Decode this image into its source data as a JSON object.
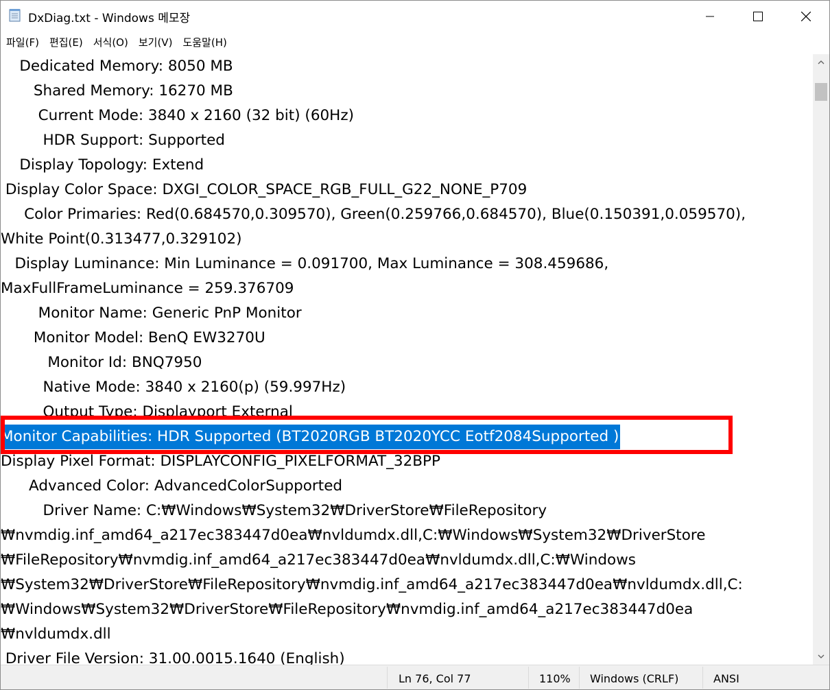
{
  "window": {
    "title": "DxDiag.txt - Windows 메모장"
  },
  "menu": [
    "파일(F)",
    "편집(E)",
    "서식(O)",
    "보기(V)",
    "도움말(H)"
  ],
  "lines": [
    "    Dedicated Memory: 8050 MB",
    "       Shared Memory: 16270 MB",
    "        Current Mode: 3840 x 2160 (32 bit) (60Hz)",
    "         HDR Support: Supported",
    "    Display Topology: Extend",
    " Display Color Space: DXGI_COLOR_SPACE_RGB_FULL_G22_NONE_P709",
    "     Color Primaries: Red(0.684570,0.309570), Green(0.259766,0.684570), Blue(0.150391,0.059570),",
    "White Point(0.313477,0.329102)",
    "   Display Luminance: Min Luminance = 0.091700, Max Luminance = 308.459686,",
    "MaxFullFrameLuminance = 259.376709",
    "        Monitor Name: Generic PnP Monitor",
    "       Monitor Model: BenQ EW3270U",
    "          Monitor Id: BNQ7950",
    "         Native Mode: 3840 x 2160(p) (59.997Hz)",
    "         Output Type: Displayport External",
    "Monitor Capabilities: HDR Supported (BT2020RGB BT2020YCC Eotf2084Supported )",
    "Display Pixel Format: DISPLAYCONFIG_PIXELFORMAT_32BPP",
    "      Advanced Color: AdvancedColorSupported",
    "         Driver Name: C:₩Windows₩System32₩DriverStore₩FileRepository",
    "₩nvmdig.inf_amd64_a217ec383447d0ea₩nvldumdx.dll,C:₩Windows₩System32₩DriverStore",
    "₩FileRepository₩nvmdig.inf_amd64_a217ec383447d0ea₩nvldumdx.dll,C:₩Windows",
    "₩System32₩DriverStore₩FileRepository₩nvmdig.inf_amd64_a217ec383447d0ea₩nvldumdx.dll,C:",
    "₩Windows₩System32₩DriverStore₩FileRepository₩nvmdig.inf_amd64_a217ec383447d0ea",
    "₩nvldumdx.dll",
    " Driver File Version: 31.00.0015.1640 (English)"
  ],
  "selected_line": 15,
  "status": {
    "position": "Ln 76, Col 77",
    "zoom": "110%",
    "line_ending": "Windows (CRLF)",
    "encoding": "ANSI"
  },
  "colors": {
    "selection": "#0078d7",
    "highlight_box": "#ff0000"
  }
}
